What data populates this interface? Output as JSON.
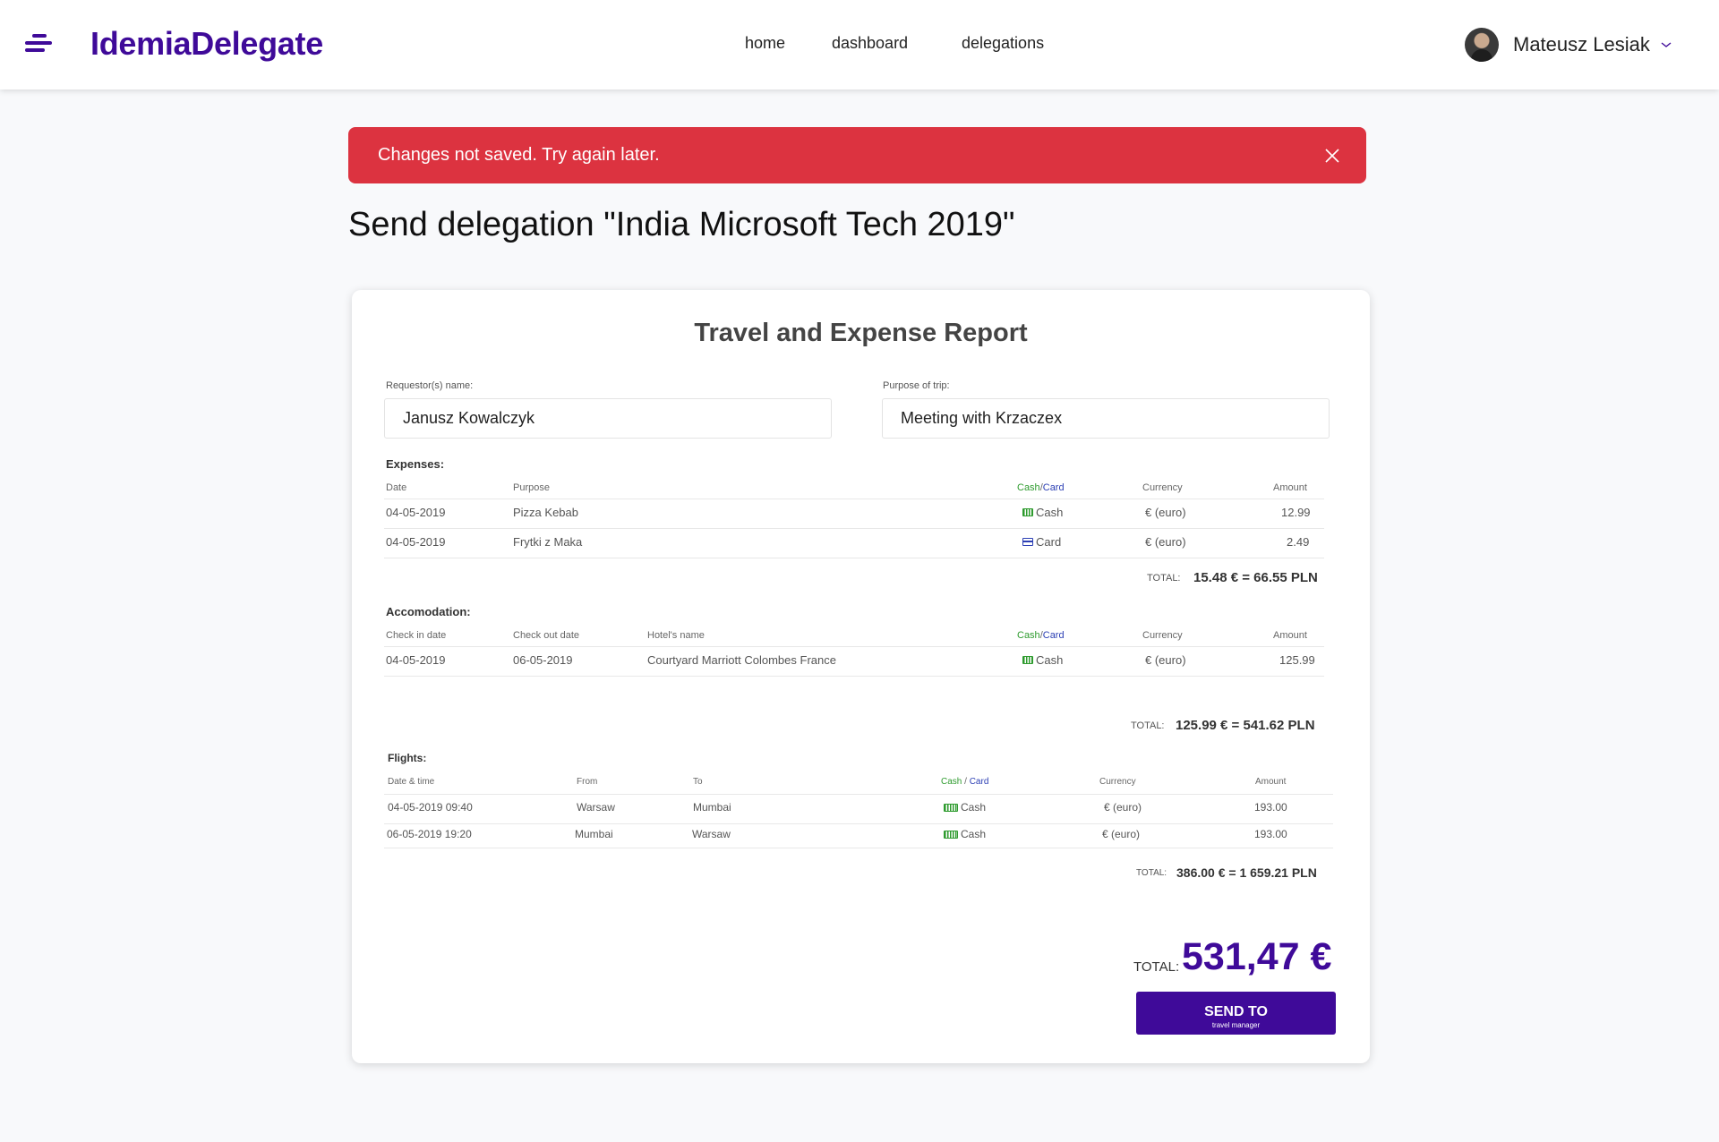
{
  "header": {
    "logo": "IdemiaDelegate",
    "nav": [
      "home",
      "dashboard",
      "delegations"
    ],
    "user_name": "Mateusz Lesiak"
  },
  "alert": {
    "text": "Changes not saved. Try again later."
  },
  "page_title": "Send delegation \"India Microsoft Tech 2019\"",
  "report": {
    "title": "Travel and Expense Report",
    "requestor_label": "Requestor(s) name:",
    "requestor_value": "Janusz Kowalczyk",
    "purpose_label": "Purpose of trip:",
    "purpose_value": "Meeting with Krzaczex",
    "expenses": {
      "label": "Expenses:",
      "headers": {
        "date": "Date",
        "purpose": "Purpose",
        "cash": "Cash",
        "sep": "/",
        "card": "Card",
        "currency": "Currency",
        "amount": "Amount"
      },
      "rows": [
        {
          "date": "04-05-2019",
          "purpose": "Pizza Kebab",
          "pay": "Cash",
          "pay_icon": "cash-icon",
          "currency": "€ (euro)",
          "amount": "12.99"
        },
        {
          "date": "04-05-2019",
          "purpose": "Frytki z Maka",
          "pay": "Card",
          "pay_icon": "credit-card-icon",
          "currency": "€ (euro)",
          "amount": "2.49"
        }
      ],
      "total_label": "TOTAL:",
      "total_value": "15.48 € = 66.55 PLN"
    },
    "accommodation": {
      "label": "Accomodation:",
      "headers": {
        "checkin": "Check in date",
        "checkout": "Check out date",
        "hotel": "Hotel's name",
        "cash": "Cash",
        "sep": "/",
        "card": "Card",
        "currency": "Currency",
        "amount": "Amount"
      },
      "rows": [
        {
          "checkin": "04-05-2019",
          "checkout": "06-05-2019",
          "hotel": "Courtyard Marriott Colombes France",
          "pay": "Cash",
          "pay_icon": "cash-icon",
          "currency": "€ (euro)",
          "amount": "125.99"
        }
      ],
      "total_label": "TOTAL:",
      "total_value": "125.99 € = 541.62 PLN"
    },
    "flights": {
      "label": "Flights:",
      "headers": {
        "datetime": "Date & time",
        "from": "From",
        "to": "To",
        "cash": "Cash",
        "sep": "/",
        "card": "Card",
        "currency": "Currency",
        "amount": "Amount"
      },
      "rows": [
        {
          "datetime": "04-05-2019 09:40",
          "from": "Warsaw",
          "to": "Mumbai",
          "pay": "Cash",
          "pay_icon": "cash-icon",
          "currency": "€ (euro)",
          "amount": "193.00"
        },
        {
          "datetime": "06-05-2019 19:20",
          "from": "Mumbai",
          "to": "Warsaw",
          "pay": "Cash",
          "pay_icon": "cash-icon",
          "currency": "€ (euro)",
          "amount": "193.00"
        }
      ],
      "total_label": "TOTAL:",
      "total_value": "386.00 € = 1 659.21 PLN"
    },
    "grand_total_label": "TOTAL:",
    "grand_total_value": "531,47 €",
    "send_button": {
      "main": "SEND TO",
      "sub": "travel manager"
    }
  },
  "colors": {
    "brand": "#3f0a99",
    "alert": "#dc3340",
    "cash": "#2e9b2e",
    "card": "#2c3fb4"
  }
}
